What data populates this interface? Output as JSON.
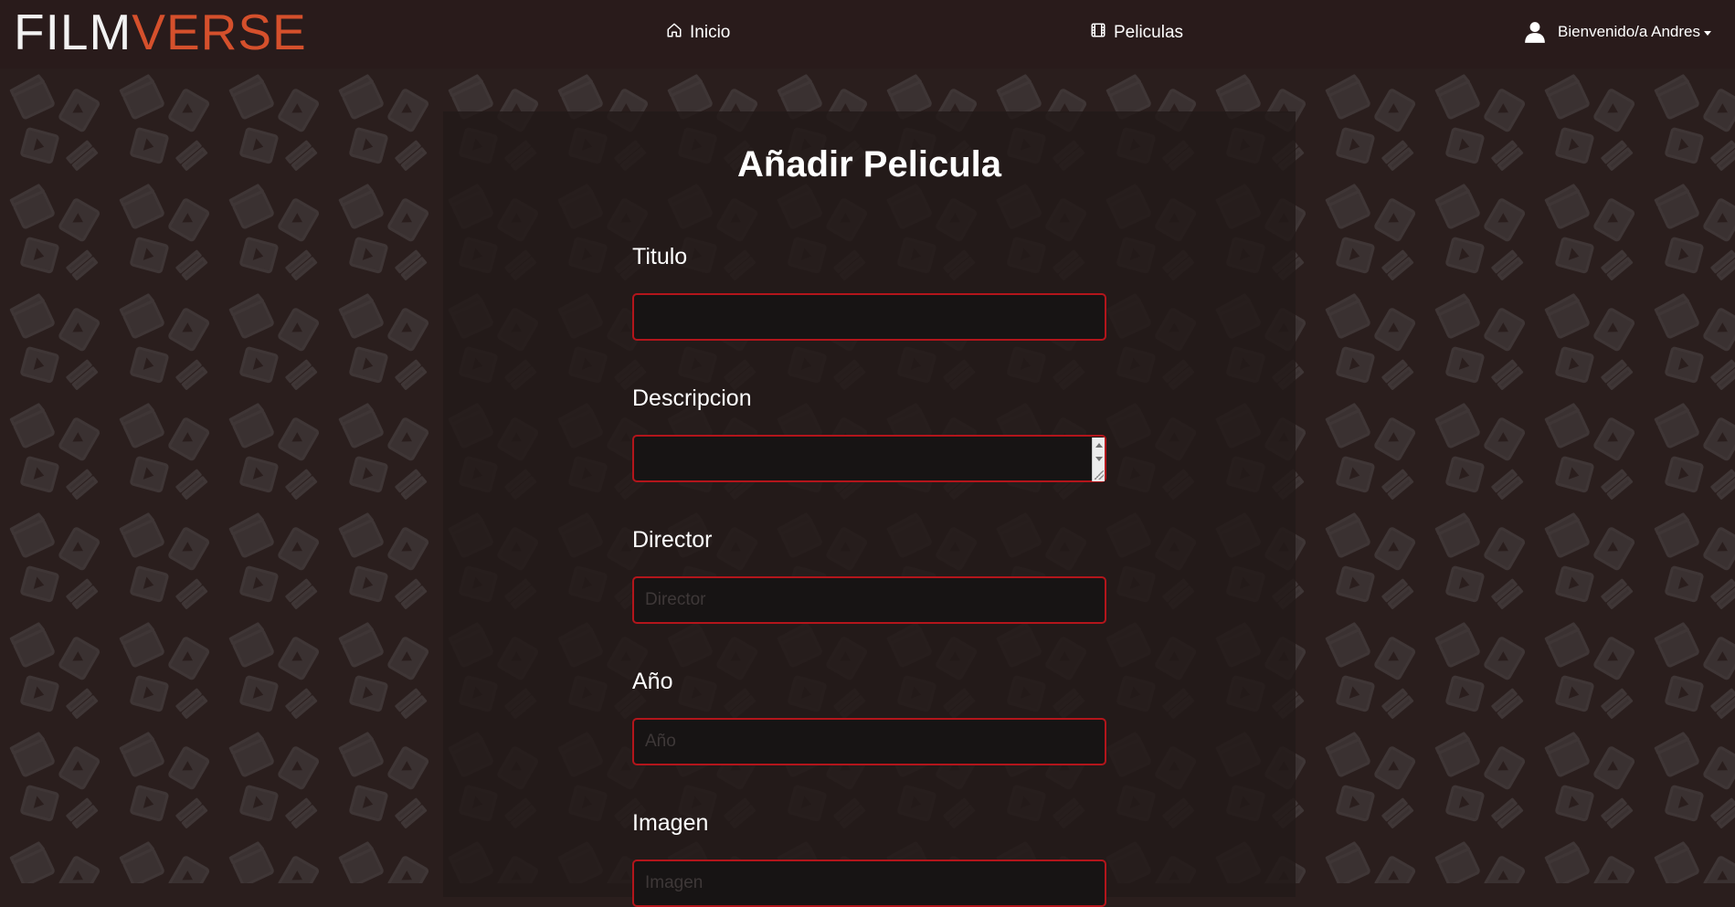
{
  "brand": {
    "part1": "FILM",
    "part2": "VERSE",
    "color_part1": "#f2f2f2",
    "color_part2": "#d5502c"
  },
  "nav": {
    "home_label": "Inicio",
    "home_icon": "home-icon",
    "movies_label": "Peliculas",
    "movies_icon": "film-icon",
    "user_label": "Bienvenido/a Andres",
    "user_icon": "user-icon"
  },
  "form": {
    "title": "Añadir Pelicula",
    "fields": [
      {
        "label": "Titulo",
        "value": "",
        "placeholder": ""
      },
      {
        "label": "Descripcion",
        "value": "",
        "placeholder": ""
      },
      {
        "label": "Director",
        "value": "",
        "placeholder": "Director"
      },
      {
        "label": "Año",
        "value": "",
        "placeholder": "Año"
      },
      {
        "label": "Imagen",
        "value": "",
        "placeholder": "Imagen"
      }
    ]
  },
  "colors": {
    "navbar_bg": "#291b1b",
    "page_bg": "#2a1e1d",
    "input_border": "#b3151b",
    "input_bg": "#171414",
    "brand_accent": "#d5502c"
  }
}
